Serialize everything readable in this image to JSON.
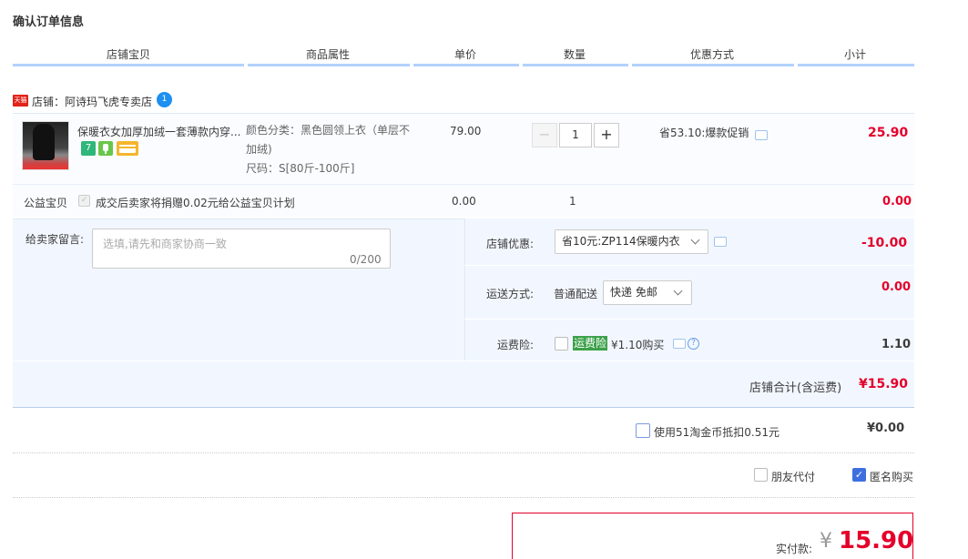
{
  "page": {
    "title": "确认订单信息"
  },
  "columns": [
    "店铺宝贝",
    "商品属性",
    "单价",
    "数量",
    "优惠方式",
    "小计"
  ],
  "shop": {
    "badge": "天猫",
    "label": "店铺：阿诗玛飞虎专卖店",
    "chat_badge": "1"
  },
  "item": {
    "title": "保暖衣女加厚加绒一套薄款内穿...",
    "badges": [
      "7",
      "",
      ""
    ],
    "props": {
      "color_line1": "颜色分类：黑色圆领上衣（单层不",
      "color_line2": "加绒)",
      "size": "尺码：S[80斤-100斤]"
    },
    "price": "79.00",
    "qty_minus": "−",
    "quantity": "1",
    "qty_plus": "+",
    "promo": "省53.10:爆款促销",
    "subtotal": "25.90"
  },
  "charity": {
    "label": "公益宝贝",
    "text": "成交后卖家将捐赠0.02元给公益宝贝计划",
    "price": "0.00",
    "qty": "1",
    "subtotal": "0.00"
  },
  "message": {
    "label": "给卖家留言:",
    "placeholder": "选填,请先和商家协商一致",
    "count": "0/200"
  },
  "shop_discount": {
    "label": "店铺优惠:",
    "value": "省10元:ZP114保暖内衣",
    "amount": "-10.00"
  },
  "shipping": {
    "label": "运送方式:",
    "method": "普通配送",
    "value": "快递 免邮",
    "amount": "0.00"
  },
  "insurance": {
    "label": "运费险:",
    "badge": "运费险",
    "text": "¥1.10购买",
    "help": "?",
    "amount": "1.10"
  },
  "shop_total": {
    "label": "店铺合计(含运费)",
    "amount": "¥15.90"
  },
  "coins": {
    "label": "使用51淘金币抵扣0.51元",
    "amount": "¥0.00"
  },
  "options": {
    "friend_pay": "朋友代付",
    "anonymous": "匿名购买"
  },
  "payment": {
    "label": "实付款:",
    "currency": "¥",
    "amount": "15.90"
  },
  "colors": {
    "accent_red": "#e4002b",
    "header_line": "#b2d1ff",
    "panel_bg": "#f2f7ff"
  }
}
